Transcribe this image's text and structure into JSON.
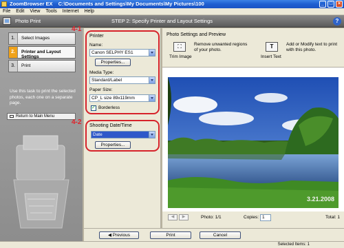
{
  "window": {
    "app_name": "ZoomBrowser EX",
    "path": "C:\\Documents and Settings\\My Documents\\My Pictures\\100"
  },
  "menu": [
    "File",
    "Edit",
    "View",
    "Tools",
    "Internet",
    "Help"
  ],
  "header": {
    "title": "Photo Print",
    "step_title": "STEP 2: Specify Printer and Layout Settings"
  },
  "sidebar": {
    "steps": [
      {
        "num": "1.",
        "label": "Select Images"
      },
      {
        "num": "2.",
        "label": "Printer and Layout Settings"
      },
      {
        "num": "3.",
        "label": "Print"
      }
    ],
    "description": "Use this task to print the selected photos, each one on a separate page.",
    "return_label": "Return to Main Menu"
  },
  "annotations": {
    "a1": "4-1",
    "a2": "4-2"
  },
  "printer": {
    "group": "Printer",
    "name_label": "Name:",
    "name_value": "Canon SELPHY ES1",
    "properties": "Properties...",
    "media_label": "Media Type:",
    "media_value": "Standard/Label",
    "paper_label": "Paper Size:",
    "paper_value": "CP_L size 89x119mm",
    "borderless": "Borderless"
  },
  "shooting": {
    "group": "Shooting Date/Time",
    "value": "Date",
    "properties": "Properties..."
  },
  "photo_settings": {
    "title": "Photo Settings and Preview",
    "trim_label": "Trim Image",
    "trim_desc": "Remove unwanted regions of your photo.",
    "text_label": "Insert Text",
    "text_desc": "Add or Modify text to print with this photo.",
    "datestamp": "3.21.2008"
  },
  "nav": {
    "photo": "Photo: 1/1",
    "copies_label": "Copies:",
    "copies_value": "1",
    "total": "Total: 1"
  },
  "buttons": {
    "previous": "Previous",
    "print": "Print",
    "cancel": "Cancel"
  },
  "status": {
    "selected": "Selected Items: 1"
  }
}
